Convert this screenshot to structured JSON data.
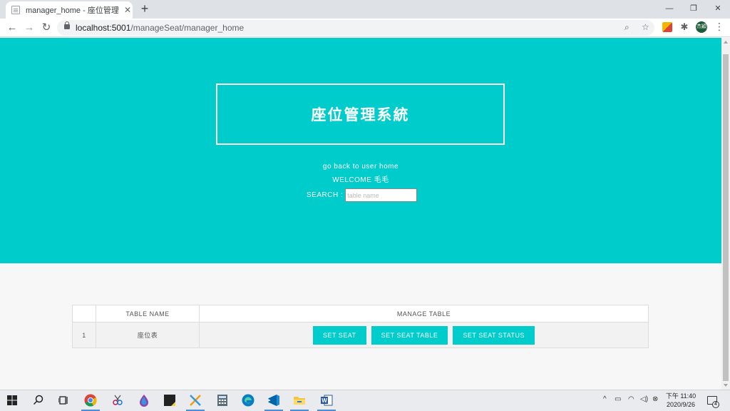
{
  "browser": {
    "tab_title": "manager_home - 座位管理系統",
    "tab_close": "✕",
    "new_tab": "+",
    "url_host": "localhost:5001",
    "url_path": "/manageSeat/manager_home",
    "avatar_text": "杰穎",
    "window_controls": [
      "—",
      "❐",
      "✕"
    ]
  },
  "header": {
    "title": "座位管理系統",
    "back_link": "go back to user home",
    "welcome": "WELCOME 毛毛",
    "search_label": "SEARCH :",
    "search_placeholder": "table name",
    "search_value": ""
  },
  "table": {
    "columns": [
      "",
      "TABLE NAME",
      "MANAGE TABLE"
    ],
    "rows": [
      {
        "index": "1",
        "name": "座位表",
        "actions": [
          "SET SEAT",
          "SET SEAT TABLE",
          "SET SEAT STATUS"
        ]
      }
    ]
  },
  "taskbar": {
    "clock_time": "下午 11:40",
    "clock_date": "2020/9/26",
    "notification_count": "4"
  },
  "colors": {
    "accent": "#00cccc",
    "page_bg": "#f7f7f7"
  }
}
